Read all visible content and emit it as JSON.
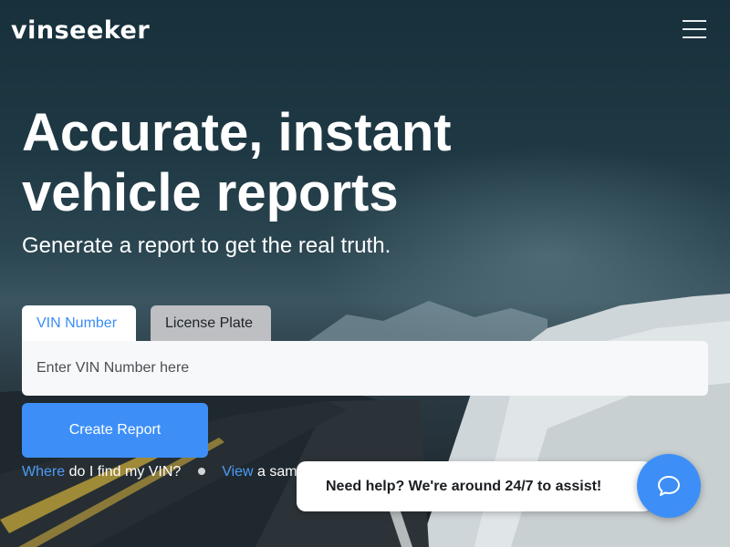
{
  "brand": {
    "logo_text": "vinseeker"
  },
  "header": {
    "menu_icon": "hamburger-menu-icon"
  },
  "hero": {
    "headline": "Accurate, instant vehicle reports",
    "subheadline": "Generate a report to get the real truth."
  },
  "search": {
    "tabs": [
      {
        "label": "VIN Number",
        "active": true
      },
      {
        "label": "License Plate",
        "active": false
      }
    ],
    "placeholder": "Enter VIN Number here",
    "value": "",
    "submit_label": "Create Report"
  },
  "help_links": {
    "find_vin_link": "Where",
    "find_vin_rest": " do I find my VIN?",
    "sample_link": "View",
    "sample_rest": " a sam"
  },
  "chat": {
    "message": "Need help? We're around 24/7 to assist!",
    "icon": "chat-bubble-icon"
  },
  "colors": {
    "accent": "#3d8ff7",
    "link": "#4d9bf8",
    "tab_inactive": "#bdbfc2"
  }
}
